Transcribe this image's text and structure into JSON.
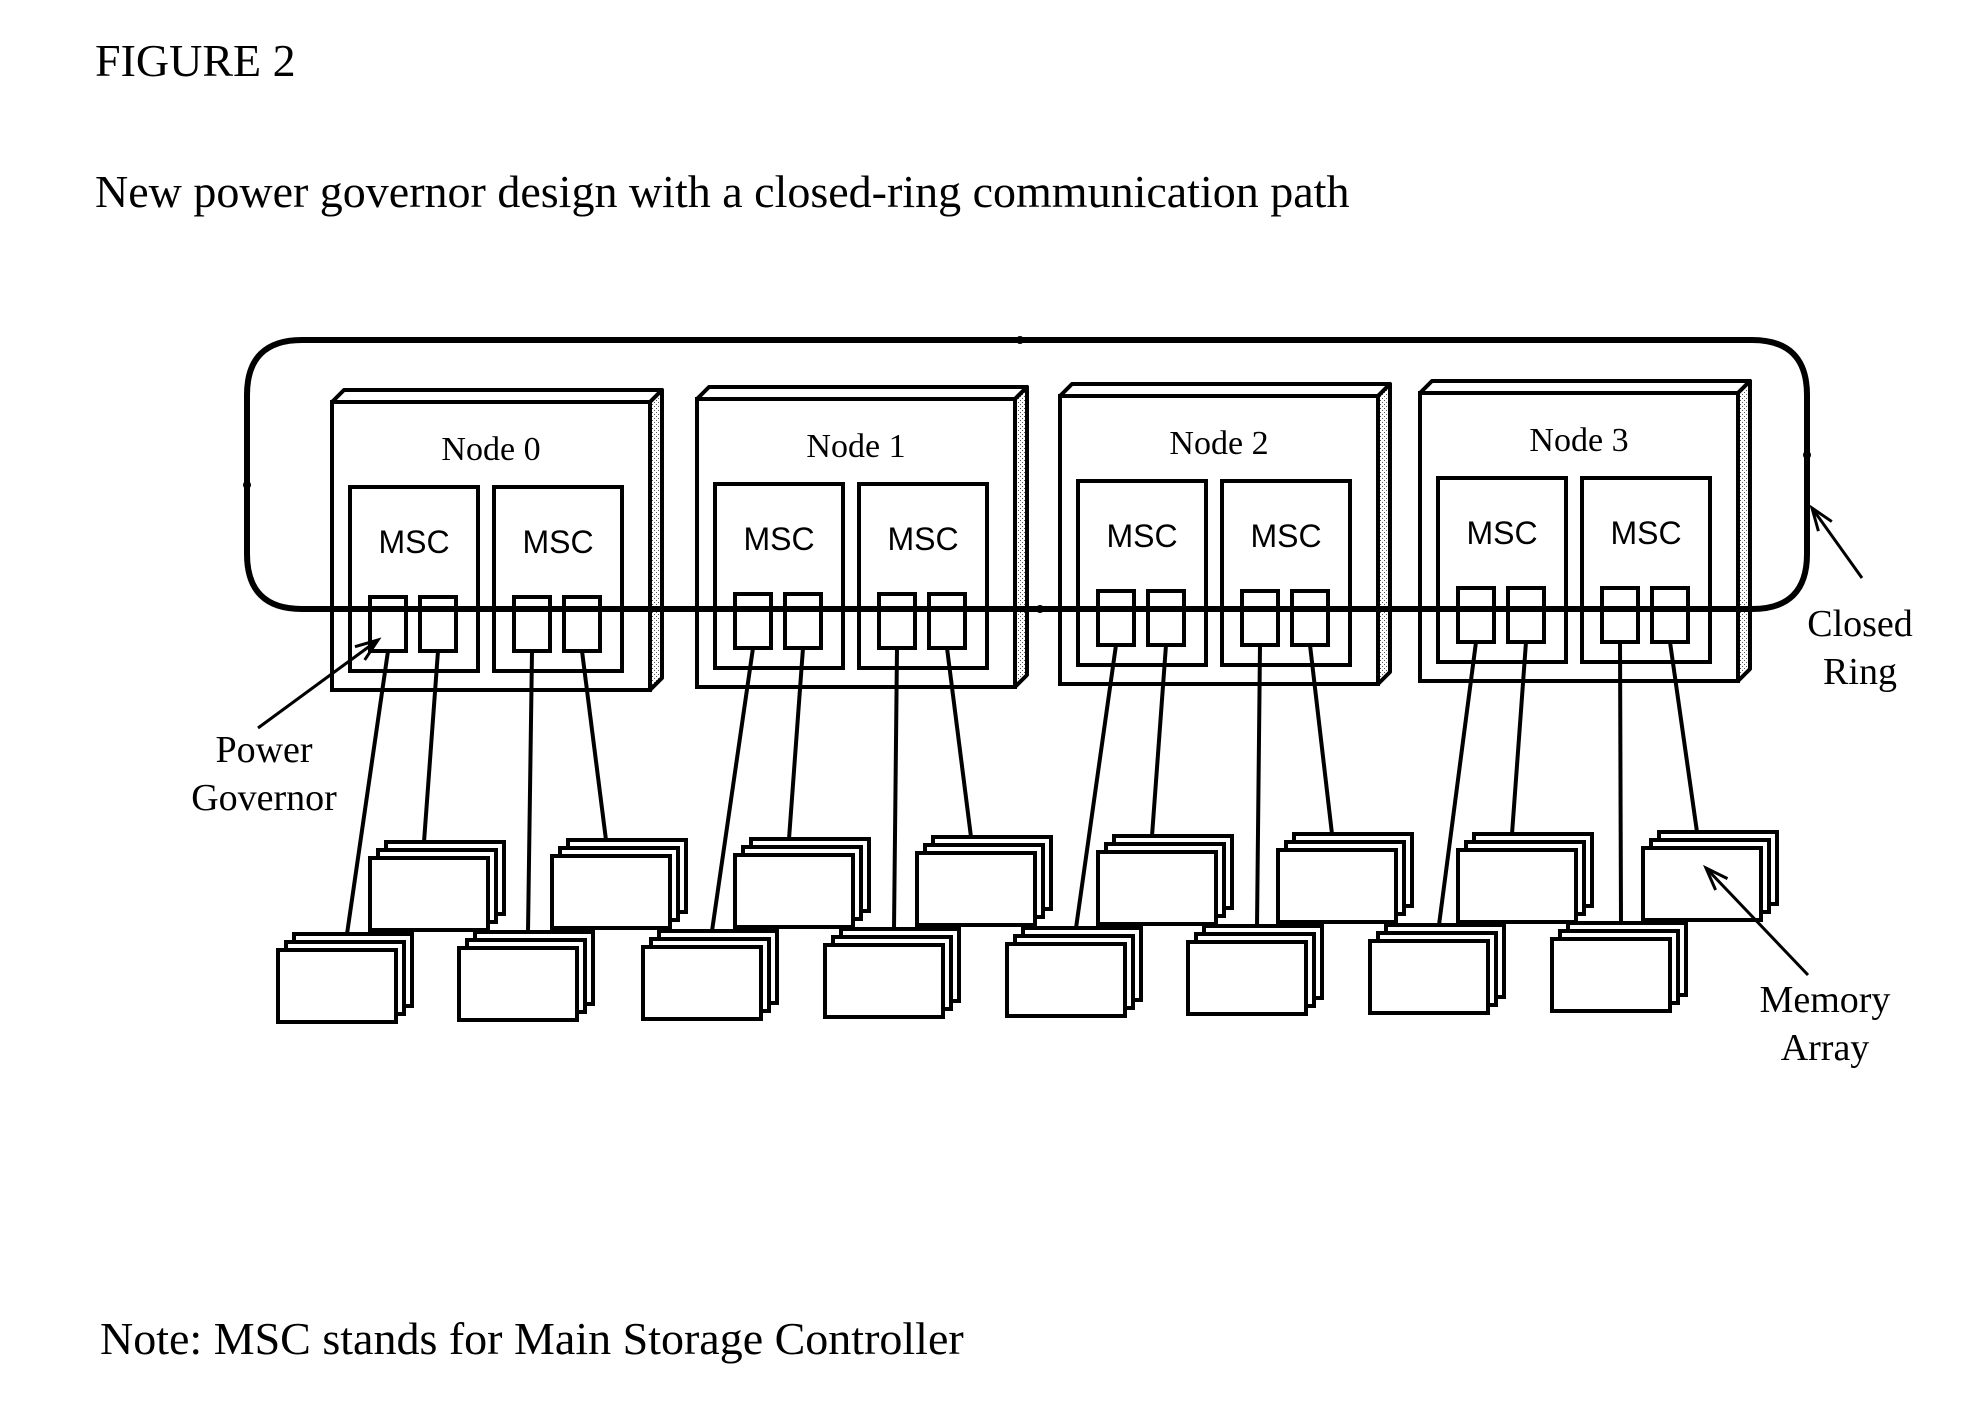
{
  "figure": {
    "label": "FIGURE 2",
    "title": "New power governor design with a closed-ring communication path",
    "note": "Note: MSC stands for Main Storage Controller"
  },
  "nodes": [
    {
      "label": "Node 0",
      "controllers": [
        "MSC",
        "MSC"
      ]
    },
    {
      "label": "Node 1",
      "controllers": [
        "MSC",
        "MSC"
      ]
    },
    {
      "label": "Node 2",
      "controllers": [
        "MSC",
        "MSC"
      ]
    },
    {
      "label": "Node 3",
      "controllers": [
        "MSC",
        "MSC"
      ]
    }
  ],
  "callouts": {
    "power_governor": [
      "Power",
      "Governor"
    ],
    "closed_ring": [
      "Closed",
      "Ring"
    ],
    "memory_array": [
      "Memory",
      "Array"
    ]
  },
  "structure": {
    "ports_per_msc": 2,
    "memory_arrays_per_node": 4,
    "ring_type": "closed-ring"
  }
}
